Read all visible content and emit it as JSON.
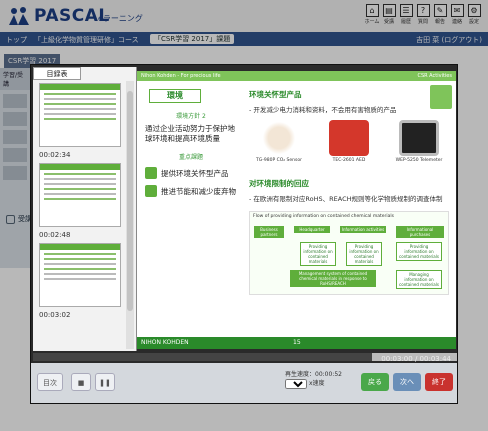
{
  "header": {
    "logo_text": "PASCAL",
    "logo_sub": "eラーニング",
    "icons": [
      {
        "name": "home-icon",
        "glyph": "⌂",
        "label": "ホーム"
      },
      {
        "name": "course-icon",
        "glyph": "▤",
        "label": "受講"
      },
      {
        "name": "history-icon",
        "glyph": "☰",
        "label": "履歴"
      },
      {
        "name": "qa-icon",
        "glyph": "?",
        "label": "質問"
      },
      {
        "name": "report-icon",
        "glyph": "✎",
        "label": "報告"
      },
      {
        "name": "notice-icon",
        "glyph": "✉",
        "label": "連絡"
      },
      {
        "name": "settings-icon",
        "glyph": "⚙",
        "label": "設定"
      }
    ]
  },
  "breadcrumb": {
    "item1": "トップ",
    "item2": "「上級化学物質管理研修」コース",
    "item3": "「CSR学習 2017」課題",
    "user": "吉田 菜 (ログアウト)"
  },
  "page": {
    "title": "CSR学習 2017",
    "left_header": "学習/受講",
    "link": "受講を完了"
  },
  "player": {
    "tab_label": "目録表",
    "thumb_times": [
      "00:02:34",
      "00:02:48",
      "00:03:02"
    ],
    "elapsed": "00:03:00",
    "total": "00:03:44",
    "progress": 0.8,
    "speed_label": "再生速度：00:00:52",
    "speed_value": "1",
    "speed_unit": "x速度",
    "buttons": {
      "menu": "目次",
      "stop": "■",
      "pause": "❚❚",
      "prev": "戻る",
      "next": "次へ",
      "finish": "終了"
    }
  },
  "slide": {
    "top_left": "Nihon Kohden - For precious life",
    "top_right": "CSR Activities",
    "env_title": "環境",
    "policy_label": "環境方針 2",
    "goal": "通过企业活动努力于保护地球环境和提高环境质量",
    "key_label": "重点課題",
    "key1": "提供环境关怀型产品",
    "key2": "推进节能和减少废弃物",
    "sec1_title": "环境关怀型产品",
    "sec1_sub": "- 开发减少电力消耗和资料，不会用有害物质的产品",
    "products": [
      {
        "name": "TG-980P CO₂ Sensor"
      },
      {
        "name": "TEC-2601 AED"
      },
      {
        "name": "WEP-5250 Telemeter"
      }
    ],
    "sec2_title": "对环境限制的回应",
    "sec2_sub": "- 在欧洲有限制对应RoHS、REACH规则等化学物质规制的调查体制",
    "diagram_note": "Flow of providing information on contained chemical materials",
    "diagram_boxes": [
      "Business partners",
      "Headquarter",
      "Information activities",
      "Informational purchases",
      "Providing information on contained materials",
      "Providing information on contained materials",
      "Providing information on contained materials",
      "Management system of contained chemical materials in response to RoHS/REACH",
      "Managing information on contained materials"
    ],
    "footer": "NIHON KOHDEN",
    "page_num": "15"
  }
}
